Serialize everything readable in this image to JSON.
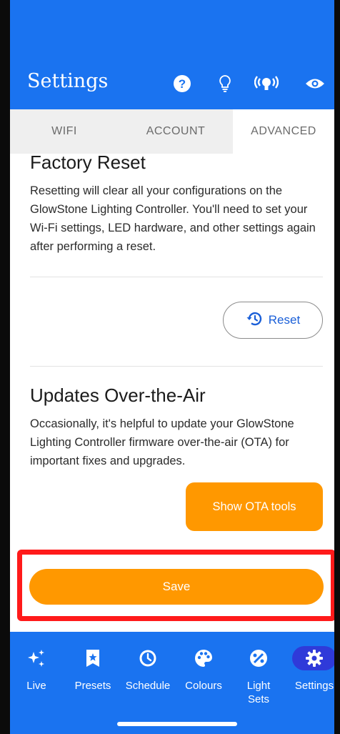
{
  "header": {
    "title": "Settings",
    "icons": [
      "help-icon",
      "lightbulb-icon",
      "broadcast-icon",
      "eye-icon"
    ]
  },
  "tabs": [
    {
      "label": "WIFI",
      "active": false
    },
    {
      "label": "ACCOUNT",
      "active": false
    },
    {
      "label": "ADVANCED",
      "active": true
    }
  ],
  "factory_reset": {
    "heading": "Factory Reset",
    "description": "Resetting will clear all your configurations on the GlowStone Lighting Controller. You'll need to set your Wi-Fi settings, LED hardware, and other settings again after performing a reset.",
    "button_label": "Reset"
  },
  "ota": {
    "heading": "Updates Over-the-Air",
    "description": "Occasionally, it's helpful to update your GlowStone Lighting Controller firmware over-the-air (OTA) for important fixes and upgrades.",
    "button_label": "Show OTA tools"
  },
  "save": {
    "label": "Save"
  },
  "nav": [
    {
      "label": "Live",
      "icon": "sparkle-icon"
    },
    {
      "label": "Presets",
      "icon": "star-bookmark-icon"
    },
    {
      "label": "Schedule",
      "icon": "clock-icon"
    },
    {
      "label": "Colours",
      "icon": "palette-icon"
    },
    {
      "label": "Light Sets",
      "icon": "light-sets-icon"
    },
    {
      "label": "Settings",
      "icon": "gear-icon",
      "active": true
    }
  ],
  "colors": {
    "primary": "#1a73f0",
    "accent": "#ff9800",
    "highlight": "#ff1a1a"
  }
}
